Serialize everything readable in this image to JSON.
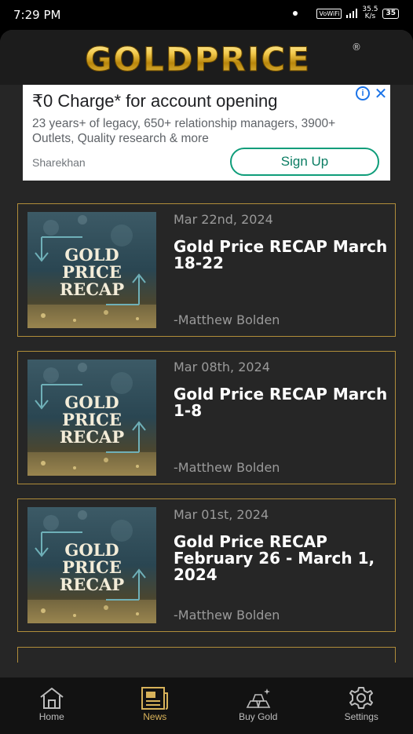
{
  "status_bar": {
    "time": "7:29 PM",
    "wifi_label": "VoWiFi",
    "speed_value": "35.5",
    "speed_unit": "K/s",
    "battery": "35"
  },
  "header": {
    "logo_text": "GOLDPRICE",
    "logo_mark": "®"
  },
  "ad": {
    "title": "₹0 Charge* for account opening",
    "description": "23 years+ of legacy, 650+ relationship managers, 3900+ Outlets, Quality research & more",
    "brand": "Sharekhan",
    "button_label": "Sign Up",
    "info_icon": "i",
    "close_icon": "✕"
  },
  "thumbnail": {
    "line1": "GOLD",
    "line2": "PRICE",
    "line3": "RECAP"
  },
  "news": [
    {
      "date": "Mar 22nd, 2024",
      "title": "Gold Price RECAP March 18-22",
      "author": "-Matthew Bolden"
    },
    {
      "date": "Mar 08th, 2024",
      "title": "Gold Price RECAP March 1-8",
      "author": "-Matthew Bolden"
    },
    {
      "date": "Mar 01st, 2024",
      "title": "Gold Price RECAP February 26 - March 1, 2024",
      "author": "-Matthew Bolden"
    }
  ],
  "bottom_nav": {
    "items": [
      {
        "label": "Home",
        "icon": "home-icon"
      },
      {
        "label": "News",
        "icon": "newspaper-icon"
      },
      {
        "label": "Buy Gold",
        "icon": "gold-bars-icon"
      },
      {
        "label": "Settings",
        "icon": "gear-icon"
      }
    ],
    "active": "News"
  },
  "colors": {
    "gold": "#d7b25a",
    "card_border": "#b08d3a",
    "background": "#262626",
    "ad_button": "#0f9d7a"
  }
}
